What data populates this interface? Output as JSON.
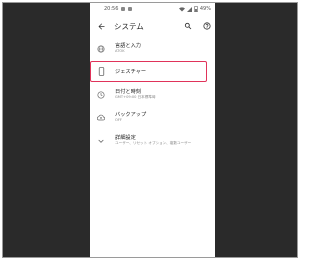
{
  "status": {
    "time": "20:56",
    "battery": "49%"
  },
  "header": {
    "title": "システム",
    "back_icon": "arrow-back-icon",
    "search_icon": "search-icon",
    "help_icon": "help-icon"
  },
  "items": [
    {
      "icon": "globe-icon",
      "title": "言語と入力",
      "subtitle": "ATOK"
    },
    {
      "icon": "phone-icon",
      "title": "ジェスチャー",
      "subtitle": ""
    },
    {
      "icon": "clock-icon",
      "title": "日付と時刻",
      "subtitle": "GMT+09:00 日本標準時"
    },
    {
      "icon": "backup-icon",
      "title": "バックアップ",
      "subtitle": "OFF"
    },
    {
      "icon": "chevron-down-icon",
      "title": "詳細設定",
      "subtitle": "ユーザー、リセット オプション、複数ユーザー"
    }
  ],
  "colors": {
    "highlight": "#e0335a",
    "background_dark": "#2a2a2a"
  }
}
